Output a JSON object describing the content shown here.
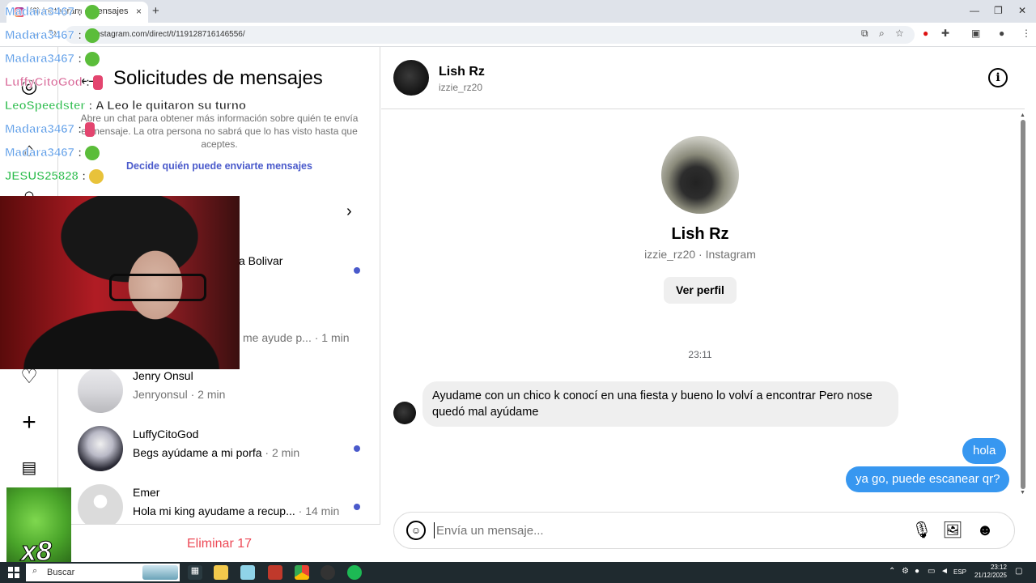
{
  "browser": {
    "tab_title": "(6) Instagram • Mensajes",
    "tab_close": "×",
    "new_tab": "+",
    "url": "instagram.com/direct/t/119128716146556/",
    "window_controls": [
      "—",
      "❐",
      "✕"
    ]
  },
  "requests": {
    "back_icon": "←",
    "title": "Solicitudes de mensajes",
    "info_text": "Abre un chat para obtener más información sobre quién te envía el mensaje. La otra persona no sabrá que lo has visto hasta que aceptes.",
    "who_can_message_link": "Decide quién puede enviarte mensajes",
    "hidden_requests_chevron": "›",
    "partial_name": "a Bolivar",
    "partial_preview": "me ayude p...",
    "partial_time": " · 1 min",
    "items": [
      {
        "name": "Jenry Onsul",
        "preview": "Jenryonsul",
        "time": " · 2 min",
        "unread": false
      },
      {
        "name": "LuffyCitoGod",
        "preview": "Begs ayúdame a mi porfa",
        "time": " · 2 min",
        "unread": true
      },
      {
        "name": "Emer",
        "preview": "Hola mi king ayudame a recup...",
        "time": " · 14 min",
        "unread": true
      }
    ],
    "delete_all": "Eliminar 17"
  },
  "chat": {
    "name": "Lish Rz",
    "username": "izzie_rz20",
    "info_icon": "i",
    "profile_name": "Lish Rz",
    "profile_sub": "izzie_rz20 · Instagram",
    "view_profile": "Ver perfil",
    "timestamp": "23:11",
    "incoming_message": "Ayudame con un chico k conocí en una fiesta y bueno lo volví a encontrar Pero nose quedó mal ayúdame",
    "outgoing_messages": [
      "hola",
      "ya go, puede escanear qr?"
    ],
    "input_placeholder": "Envía un mensaje..."
  },
  "overlay": {
    "chat_lines": [
      {
        "user": "Madara3467",
        "msg": " :",
        "emote": "green"
      },
      {
        "user": "Madara3467",
        "msg": " :",
        "emote": "green"
      },
      {
        "user": "Madara3467",
        "msg": " :",
        "emote": "green"
      },
      {
        "user": "LuffyCitoGod",
        "msg": " :",
        "emote": "pink"
      },
      {
        "user": "LeoSpeedster",
        "msg": " : A Leo le quitaron su turno",
        "emote": ""
      },
      {
        "user": "Madara3467",
        "msg": " :",
        "emote": "pink"
      },
      {
        "user": "Madara3467",
        "msg": " :",
        "emote": "green"
      },
      {
        "user": "JESUS25828",
        "msg": " :",
        "emote": "yellow"
      }
    ],
    "emote_count": "x8"
  },
  "taskbar": {
    "search": "Buscar",
    "language": "ESP",
    "time": "23:12",
    "date": "21/12/2025"
  }
}
